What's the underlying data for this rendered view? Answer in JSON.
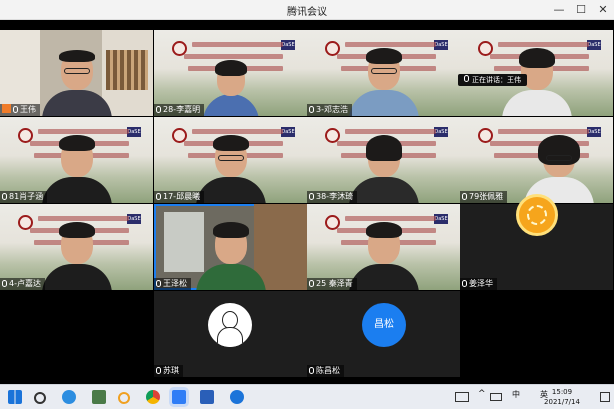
{
  "window": {
    "title": "腾讯会议",
    "minimize": "—",
    "maximize": "☐",
    "close": "✕"
  },
  "tiles": [
    {
      "id": "t1",
      "name": "王伟",
      "host": true
    },
    {
      "id": "t2",
      "name": "28-李嘉明"
    },
    {
      "id": "t3",
      "name": "3-邓志浩"
    },
    {
      "id": "t4",
      "name": ""
    },
    {
      "id": "t5",
      "name": "81肖子涵"
    },
    {
      "id": "t6",
      "name": "17-邱晨曦"
    },
    {
      "id": "t7",
      "name": "38-李沐琦"
    },
    {
      "id": "t8",
      "name": "79张佩雅"
    },
    {
      "id": "t9",
      "name": "4-卢嘉达"
    },
    {
      "id": "t10",
      "name": "王泽松"
    },
    {
      "id": "t11",
      "name": "25 秦泽青"
    },
    {
      "id": "t12",
      "name": "姜泽华"
    },
    {
      "id": "t13",
      "name": "苏琪"
    },
    {
      "id": "t14",
      "name": "陈昌松"
    }
  ],
  "slide": {
    "line1": "华东师范大学",
    "line2": "第九届“云计算与大数据”",
    "line3": "优秀大学生夏令营",
    "logo": "DaSE"
  },
  "speaking_label": "正在讲话：王伟",
  "avatar_text": "昌松",
  "clock": {
    "time": "15:09",
    "date": "2021/7/14"
  },
  "tray": {
    "ime": "中",
    "lang": "英"
  },
  "colors": {
    "accent": "#1b7ef0",
    "host_badge": "#f07c2a"
  }
}
